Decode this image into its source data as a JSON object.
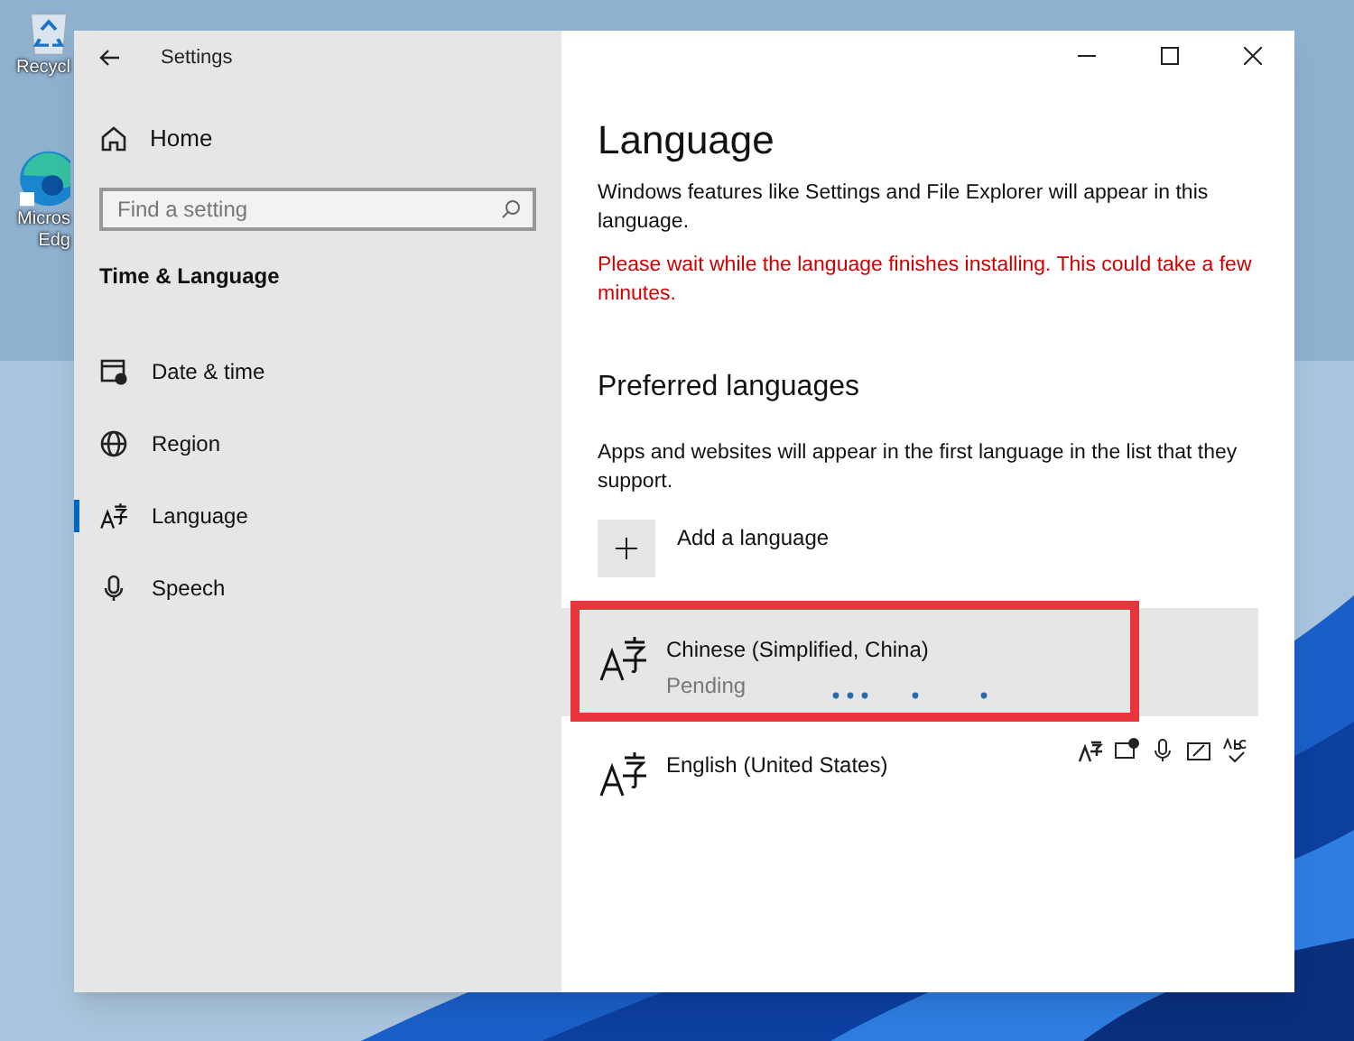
{
  "desktop_icons": [
    {
      "kind": "recycle",
      "lines": [
        "Recycl"
      ]
    },
    {
      "kind": "edge",
      "lines": [
        "Micros",
        "Edg"
      ]
    }
  ],
  "window": {
    "title": "Settings"
  },
  "sidebar": {
    "home": "Home",
    "search": {
      "placeholder": "Find a setting"
    },
    "section": "Time & Language",
    "items": [
      {
        "kind": "clock",
        "label": "Date & time",
        "selected": false
      },
      {
        "kind": "globe",
        "label": "Region",
        "selected": false
      },
      {
        "kind": "language",
        "label": "Language",
        "selected": true
      },
      {
        "kind": "mic",
        "label": "Speech",
        "selected": false
      }
    ]
  },
  "content": {
    "title": "Language",
    "intro": "Windows features like Settings and File Explorer will appear in this language.",
    "warning": "Please wait while the language finishes installing. This could take a few minutes.",
    "preferred": {
      "heading": "Preferred languages",
      "description": "Apps and websites will appear in the first language in the list that they support.",
      "add": "Add a language",
      "languages": [
        {
          "name": "Chinese (Simplified, China)",
          "status": "Pending",
          "selected": true,
          "installing": true,
          "features": false
        },
        {
          "name": "English (United States)",
          "selected": false,
          "installing": false,
          "features": true
        }
      ]
    }
  }
}
